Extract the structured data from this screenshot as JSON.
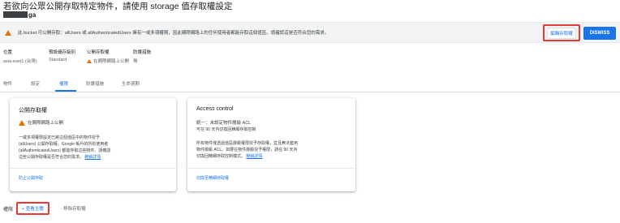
{
  "intro_text": "若欲向公眾公開存取特定物件，請使用 storage 值存取權設定",
  "bucket": {
    "name_suffix": "ga"
  },
  "warning": {
    "icon": "warning-icon",
    "text": "此 bucket 可公開存取：allUsers 或 allAuthenticatedUsers 擁有一或多項權限，因此網際網路上的任何使用者都能存取這個值區。請確認這是否符合您的需求。",
    "edit_access_label": "編輯存取權",
    "dismiss_label": "DISMISS"
  },
  "meta": {
    "location_label": "位置",
    "location_value": "asia-east1 (台灣)",
    "storage_class_label": "預設儲存級別",
    "storage_class_value": "Standard",
    "public_access_label": "公開存取權",
    "public_access_value": "在網際網路上公開",
    "protection_label": "防護措施",
    "protection_value": "無"
  },
  "tabs": [
    {
      "label": "物件"
    },
    {
      "label": "設定"
    },
    {
      "label": "權限"
    },
    {
      "label": "防護措施"
    },
    {
      "label": "生命週期"
    }
  ],
  "public_card": {
    "title": "公開存取權",
    "status": "在網際網路上公開",
    "desc_lines": [
      "一或多項權限設定已將這個值區中的物件授予",
      "(allUsers) 公開存取權，Google 帳戶的所有使用者",
      "(allAuthenticatedUsers) 都能存取這些物件。請確認",
      "這些公開存取權是否符合您的需求。"
    ],
    "learn_more": "瞭解詳情",
    "prevent_link": "防止公開存取"
  },
  "access_card": {
    "title": "Access control",
    "mode_line": "統一：未設定物件層級 ACL",
    "mode_sub": "可在 90 天內切換回精細存取控制",
    "desc_lines": [
      "所有物件僅透過值區層級權限授予存取權，並且無法套用",
      "物件層級 ACL。如要在物件層級授予權限，請在 90 天內",
      "切換回精細存取控制模式。"
    ],
    "learn_more": "瞭解詳情",
    "switch_link": "切換至精細存取權"
  },
  "permissions": {
    "label": "權限",
    "view_principals": "+ 查看主體",
    "remove_access": "- 移除存取權"
  },
  "colors": {
    "accent": "#1a73e8",
    "warning": "#e37400",
    "highlight": "#e53935"
  }
}
